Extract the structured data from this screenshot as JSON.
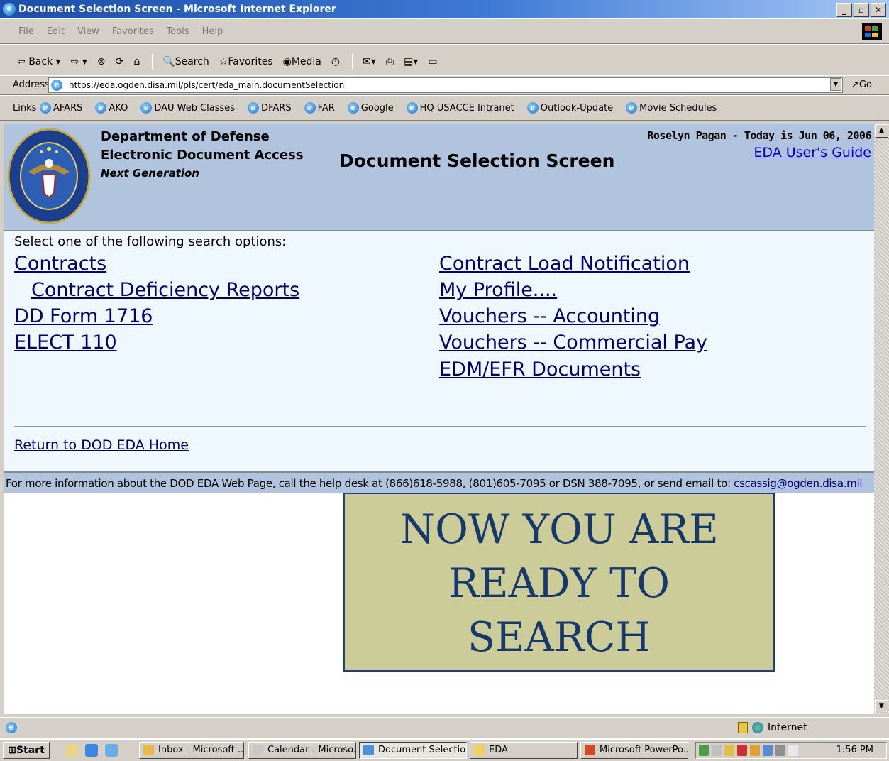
{
  "window": {
    "title": "Document Selection Screen - Microsoft Internet Explorer"
  },
  "menu": [
    "File",
    "Edit",
    "View",
    "Favorites",
    "Tools",
    "Help"
  ],
  "toolbar": {
    "back": "Back",
    "search": "Search",
    "favorites": "Favorites",
    "media": "Media"
  },
  "address": {
    "label": "Address",
    "url": "https://eda.ogden.disa.mil/pls/cert/eda_main.documentSelection",
    "go": "Go"
  },
  "links": {
    "label": "Links",
    "items": [
      "AFARS",
      "AKO",
      "DAU Web Classes",
      "DFARS",
      "FAR",
      "Google",
      "HQ USACCE Intranet",
      "Outlook-Update",
      "Movie Schedules"
    ]
  },
  "header": {
    "org_line1": "Department of Defense",
    "org_line2": "Electronic Document Access",
    "org_line3": "Next Generation",
    "screen_title": "Document Selection Screen",
    "user_line": "Roselyn Pagan - Today is Jun 06, 2006",
    "guide_link": "EDA User's Guide"
  },
  "main": {
    "prompt": "Select one of the following search options:",
    "left_links": [
      "Contracts",
      "Contract Deficiency Reports",
      "DD Form 1716",
      "ELECT 110"
    ],
    "right_links": [
      "Contract Load Notification",
      "My Profile....",
      "Vouchers -- Accounting",
      "Vouchers -- Commercial Pay",
      "EDM/EFR Documents"
    ],
    "return_link": "Return to DOD EDA Home"
  },
  "footer": {
    "text": "For more information about the DOD EDA Web Page, call the help desk at (866)618-5988, (801)605-7095 or DSN 388-7095, or send email to: ",
    "email": "cscassig@ogden.disa.mil"
  },
  "banner": {
    "line1": "NOW YOU ARE",
    "line2": "READY TO",
    "line3": "SEARCH"
  },
  "status": {
    "zone": "Internet"
  },
  "taskbar": {
    "start": "Start",
    "tasks": [
      "Inbox - Microsoft ...",
      "Calendar - Microso...",
      "Document Selectio...",
      "EDA",
      "Microsoft PowerPo..."
    ],
    "clock": "1:56 PM"
  }
}
